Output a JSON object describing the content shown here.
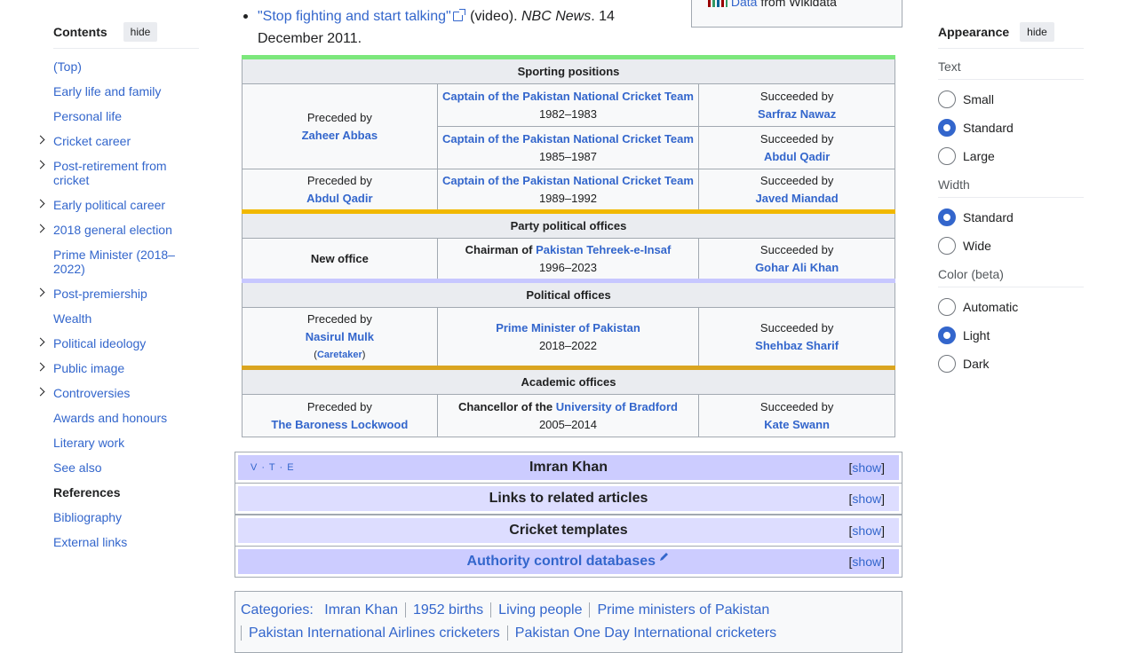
{
  "toc": {
    "title": "Contents",
    "hide_label": "hide",
    "items": [
      {
        "label": "(Top)",
        "expandable": false,
        "current": false
      },
      {
        "label": "Early life and family",
        "expandable": false,
        "current": false
      },
      {
        "label": "Personal life",
        "expandable": false,
        "current": false
      },
      {
        "label": "Cricket career",
        "expandable": true,
        "current": false
      },
      {
        "label": "Post-retirement from cricket",
        "expandable": true,
        "current": false
      },
      {
        "label": "Early political career",
        "expandable": true,
        "current": false
      },
      {
        "label": "2018 general election",
        "expandable": true,
        "current": false
      },
      {
        "label": "Prime Minister (2018–2022)",
        "expandable": false,
        "current": false
      },
      {
        "label": "Post-premiership",
        "expandable": true,
        "current": false
      },
      {
        "label": "Wealth",
        "expandable": false,
        "current": false
      },
      {
        "label": "Political ideology",
        "expandable": true,
        "current": false
      },
      {
        "label": "Public image",
        "expandable": true,
        "current": false
      },
      {
        "label": "Controversies",
        "expandable": true,
        "current": false
      },
      {
        "label": "Awards and honours",
        "expandable": false,
        "current": false
      },
      {
        "label": "Literary work",
        "expandable": false,
        "current": false
      },
      {
        "label": "See also",
        "expandable": false,
        "current": false
      },
      {
        "label": "References",
        "expandable": false,
        "current": true
      },
      {
        "label": "Bibliography",
        "expandable": false,
        "current": false
      },
      {
        "label": "External links",
        "expandable": false,
        "current": false
      }
    ]
  },
  "bullet": {
    "link": "\"Stop fighting and start talking\"",
    "rest1": " (video). ",
    "source": "NBC News",
    "rest2": ". 14 December 2011."
  },
  "wikidata": {
    "link": "Data",
    "rest": " from Wikidata"
  },
  "succession": {
    "sporting_header": "Sporting positions",
    "party_header": "Party political offices",
    "political_header": "Political offices",
    "academic_header": "Academic offices",
    "preceded_by": "Preceded by",
    "succeeded_by": "Succeeded by",
    "captain_title": "Captain of the Pakistan National Cricket Team",
    "zaheer": "Zaheer Abbas",
    "y1": "1982–1983",
    "sarfraz": "Sarfraz Nawaz",
    "y2": "1985–1987",
    "abdul1": "Abdul Qadir",
    "abdul2": "Abdul Qadir",
    "y3": "1989–1992",
    "javed": "Javed Miandad",
    "new_office": "New office",
    "chairman_of": "Chairman of ",
    "pti": "Pakistan Tehreek-e-Insaf",
    "y4": "1996–2023",
    "gohar": "Gohar Ali Khan",
    "nasirul": "Nasirul Mulk",
    "caretaker": "Caretaker",
    "pm_title": "Prime Minister of Pakistan",
    "y5": "2018–2022",
    "shehbaz": "Shehbaz Sharif",
    "lockwood": "The Baroness Lockwood",
    "chancellor_of": "Chancellor of the ",
    "bradford": "University of Bradford",
    "y6": "2005–2014",
    "kate": "Kate Swann"
  },
  "navboxes": [
    {
      "title": "Imran Khan",
      "show": "show",
      "vte": "V · T · E"
    },
    {
      "title": "Links to related articles",
      "show": "show"
    },
    {
      "title": "Cricket templates",
      "show": "show"
    },
    {
      "title": "Authority control databases",
      "show": "show"
    }
  ],
  "categories": {
    "label": "Categories:",
    "items": [
      "Imran Khan",
      "1952 births",
      "Living people",
      "Prime ministers of Pakistan",
      "Pakistan International Airlines cricketers",
      "Pakistan One Day International cricketers"
    ]
  },
  "appearance": {
    "title": "Appearance",
    "hide_label": "hide",
    "text_label": "Text",
    "text_options": [
      "Small",
      "Standard",
      "Large"
    ],
    "text_selected": "Standard",
    "width_label": "Width",
    "width_options": [
      "Standard",
      "Wide"
    ],
    "width_selected": "Standard",
    "color_label": "Color (beta)",
    "color_options": [
      "Automatic",
      "Light",
      "Dark"
    ],
    "color_selected": "Light"
  },
  "colors": {
    "link": "#3366cc",
    "sporting_border": "#7ce77c",
    "party_border": "#f1b800",
    "political_border": "#c7c7ff",
    "academic_border": "#daa520",
    "navbox_title_bg": "#ccccff",
    "navbox_group_bg": "#ddddff"
  }
}
